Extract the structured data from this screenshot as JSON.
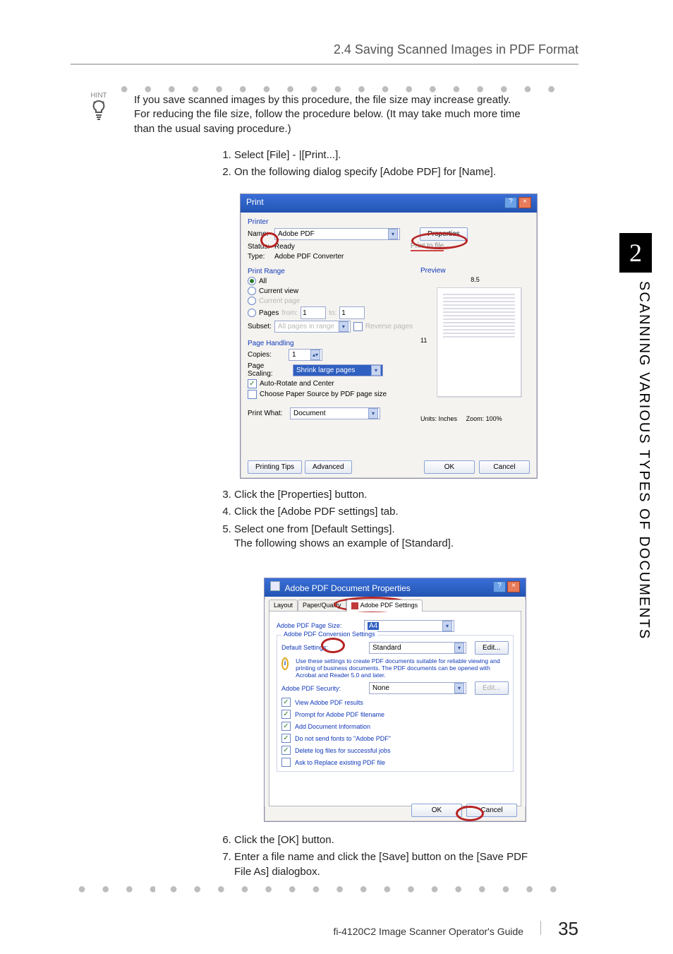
{
  "header": {
    "title": "2.4 Saving Scanned Images in PDF Format"
  },
  "sidetab": {
    "chapter": "2",
    "label": "SCANNING VARIOUS TYPES OF DOCUMENTS"
  },
  "hint": {
    "label": "HINT",
    "text": "If you save scanned images by this procedure, the file size may increase greatly. For reducing the file size, follow the procedure below. (It may take much more time than the usual saving procedure.)"
  },
  "steps_a": [
    "Select [File] - |[Print...].",
    "On the following dialog specify [Adobe PDF] for [Name]."
  ],
  "steps_b": [
    "Click the [Properties] button.",
    "Click the [Adobe PDF settings] tab.",
    "Select one from [Default Settings].",
    "The following shows an example of [Standard]."
  ],
  "steps_c": [
    "Click the [OK] button.",
    "Enter a file name and click the [Save] button on the [Save PDF File As] dialogbox."
  ],
  "print_dialog": {
    "title": "Print",
    "printer_group": "Printer",
    "name_label": "Name:",
    "name_value": "Adobe PDF",
    "properties_btn": "Properties",
    "status_label": "Status:",
    "status_value": "Ready",
    "type_label": "Type:",
    "type_value": "Adobe PDF Converter",
    "print_to_file": "Print to file",
    "range_group": "Print Range",
    "range_all": "All",
    "range_current_view": "Current view",
    "range_current_page": "Current page",
    "range_pages": "Pages",
    "from_label": "from:",
    "from_value": "1",
    "to_label": "to:",
    "to_value": "1",
    "subset_label": "Subset:",
    "subset_value": "All pages in range",
    "reverse_pages": "Reverse pages",
    "handling_group": "Page Handling",
    "copies_label": "Copies:",
    "copies_value": "1",
    "scaling_label": "Page Scaling:",
    "scaling_value": "Shrink large pages",
    "auto_rotate": "Auto-Rotate and Center",
    "choose_paper": "Choose Paper Source by PDF page size",
    "print_what_label": "Print What:",
    "print_what_value": "Document",
    "preview_label": "Preview",
    "preview_width": "8.5",
    "preview_height": "11",
    "units_label": "Units:",
    "units_value": "Inches",
    "zoom_label": "Zoom:",
    "zoom_value": "100%",
    "tips_btn": "Printing Tips",
    "advanced_btn": "Advanced",
    "ok_btn": "OK",
    "cancel_btn": "Cancel"
  },
  "props_dialog": {
    "title": "Adobe PDF Document Properties",
    "tab_layout": "Layout",
    "tab_paper": "Paper/Quality",
    "tab_pdf": "Adobe PDF Settings",
    "page_size_label": "Adobe PDF Page Size:",
    "page_size_value": "A4",
    "conversion_group": "Adobe PDF Conversion Settings",
    "default_label": "Default Settings:",
    "default_value": "Standard",
    "edit_btn": "Edit...",
    "info_text": "Use these settings to create PDF documents suitable for reliable viewing and printing of business documents. The PDF documents can be opened with Acrobat and Reader 5.0 and later.",
    "security_label": "Adobe PDF Security:",
    "security_value": "None",
    "chk_view": "View Adobe PDF results",
    "chk_prompt": "Prompt for Adobe PDF filename",
    "chk_docinfo": "Add Document Information",
    "chk_nofonts": "Do not send fonts to \"Adobe PDF\"",
    "chk_delete": "Delete log files for successful jobs",
    "chk_ask_replace": "Ask to Replace existing PDF file",
    "ok_btn": "OK",
    "cancel_btn": "Cancel"
  },
  "footer": {
    "guide": "fi-4120C2 Image Scanner Operator's Guide",
    "page": "35"
  }
}
